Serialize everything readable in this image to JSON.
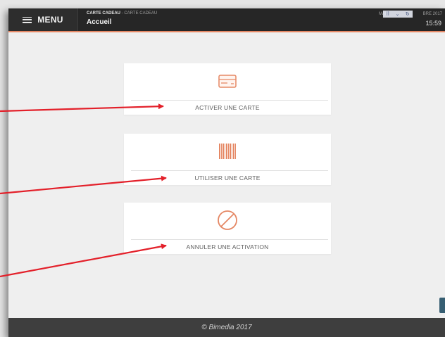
{
  "topbar": {
    "menu_label": "MENU",
    "breadcrumb_module": "CARTE CADEAU",
    "breadcrumb_separator": " - ",
    "breadcrumb_sub": "CARTE CADEAU",
    "page_title": "Accueil",
    "date_text": "MAR",
    "date_text_end": "BRE 2017",
    "time": "15:59"
  },
  "actions": [
    {
      "label": "ACTIVER UNE CARTE",
      "icon": "credit-card-icon"
    },
    {
      "label": "UTILISER UNE CARTE",
      "icon": "barcode-icon"
    },
    {
      "label": "ANNULER UNE ACTIVATION",
      "icon": "cancel-icon"
    }
  ],
  "footer": {
    "copyright": "© Bimedia 2017"
  },
  "colors": {
    "accent": "#e58865",
    "topbar": "#262626",
    "footer": "#3e3e3e",
    "annotation_arrow": "#e3202a"
  }
}
